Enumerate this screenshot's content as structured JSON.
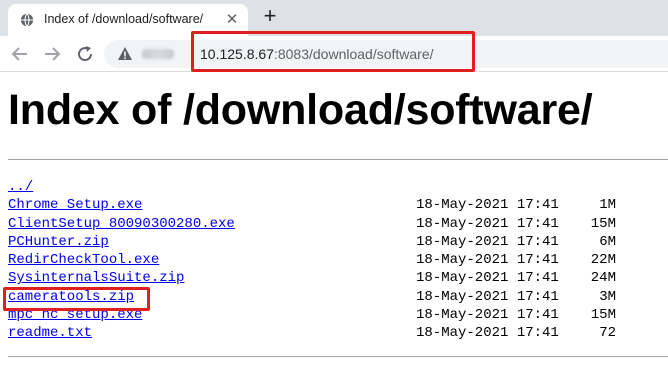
{
  "browser": {
    "tab_title": "Index of /download/software/",
    "tab_close_icon": "close-icon",
    "new_tab_icon": "plus-icon",
    "security_icon": "warning-triangle-icon",
    "url_host": "10.125.8.67",
    "url_rest": ":8083/download/software/"
  },
  "page": {
    "title": "Index of /download/software/",
    "entries": [
      {
        "name": "../",
        "date": "",
        "size": ""
      },
      {
        "name": "Chrome Setup.exe",
        "date": "18-May-2021 17:41",
        "size": "1M"
      },
      {
        "name": "ClientSetup 80090300280.exe",
        "date": "18-May-2021 17:41",
        "size": "15M"
      },
      {
        "name": "PCHunter.zip",
        "date": "18-May-2021 17:41",
        "size": "6M"
      },
      {
        "name": "RedirCheckTool.exe",
        "date": "18-May-2021 17:41",
        "size": "22M"
      },
      {
        "name": "SysinternalsSuite.zip",
        "date": "18-May-2021 17:41",
        "size": "24M"
      },
      {
        "name": "cameratools.zip",
        "date": "18-May-2021 17:41",
        "size": "3M"
      },
      {
        "name": "mpc hc setup.exe",
        "date": "18-May-2021 17:41",
        "size": "15M"
      },
      {
        "name": "readme.txt",
        "date": "18-May-2021 17:41",
        "size": "72"
      }
    ]
  },
  "colors": {
    "highlight": "#e02020",
    "link": "#0000ee"
  }
}
